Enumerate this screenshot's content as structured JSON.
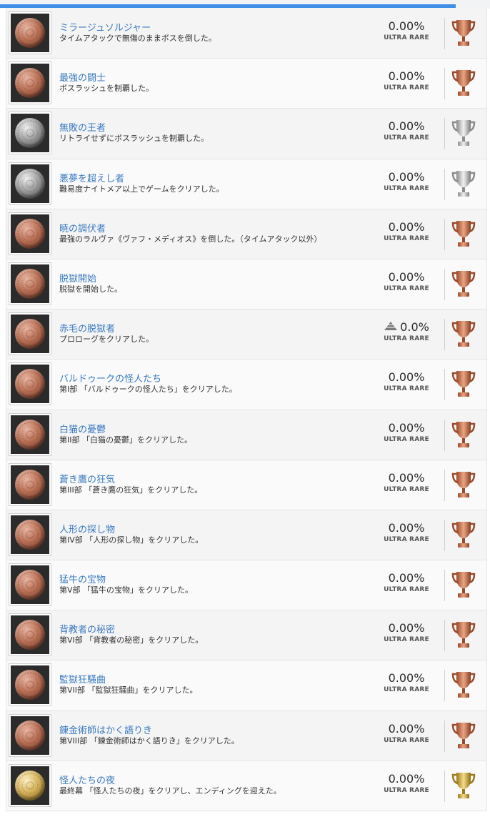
{
  "progress_percent": 93,
  "colors": {
    "title": "#3a79c1",
    "progress": "#3f8fe6",
    "bronze": "#c8714f",
    "silver": "#a8a8a8",
    "gold": "#c9a233"
  },
  "trophies": [
    {
      "title": "ミラージュソルジャー",
      "description": "タイムアタックで無傷のままボスを倒した。",
      "percent": "0.00%",
      "rarity": "ULTRA RARE",
      "grade": "bronze",
      "icon": "bronze-trophy-icon"
    },
    {
      "title": "最強の闘士",
      "description": "ボスラッシュを制覇した。",
      "percent": "0.00%",
      "rarity": "ULTRA RARE",
      "grade": "bronze",
      "icon": "bronze-trophy-icon"
    },
    {
      "title": "無敗の王者",
      "description": "リトライせずにボスラッシュを制覇した。",
      "percent": "0.00%",
      "rarity": "ULTRA RARE",
      "grade": "silver",
      "icon": "silver-trophy-icon"
    },
    {
      "title": "悪夢を超えし者",
      "description": "難易度ナイトメア以上でゲームをクリアした。",
      "percent": "0.00%",
      "rarity": "ULTRA RARE",
      "grade": "silver",
      "icon": "silver-trophy-icon"
    },
    {
      "title": "暁の調伏者",
      "description": "最強のラルヴァ《ヴァフ・メディオス》を倒した。（タイムアタック以外）",
      "percent": "0.00%",
      "rarity": "ULTRA RARE",
      "grade": "bronze",
      "icon": "bronze-trophy-icon"
    },
    {
      "title": "脱獄開始",
      "description": "脱獄を開始した。",
      "percent": "0.00%",
      "rarity": "ULTRA RARE",
      "grade": "bronze",
      "icon": "bronze-trophy-icon"
    },
    {
      "title": "赤毛の脱獄者",
      "description": "プロローグをクリアした。",
      "percent": "0.0%",
      "rarity": "ULTRA RARE",
      "grade": "bronze",
      "icon": "bronze-trophy-icon",
      "rarity_icon": "pyramid-icon"
    },
    {
      "title": "バルドゥークの怪人たち",
      "description": "第I部 「バルドゥークの怪人たち」をクリアした。",
      "percent": "0.00%",
      "rarity": "ULTRA RARE",
      "grade": "bronze",
      "icon": "bronze-trophy-icon"
    },
    {
      "title": "白猫の憂鬱",
      "description": "第II部 「白猫の憂鬱」をクリアした。",
      "percent": "0.00%",
      "rarity": "ULTRA RARE",
      "grade": "bronze",
      "icon": "bronze-trophy-icon"
    },
    {
      "title": "蒼き鷹の狂気",
      "description": "第III部 「蒼き鷹の狂気」をクリアした。",
      "percent": "0.00%",
      "rarity": "ULTRA RARE",
      "grade": "bronze",
      "icon": "bronze-trophy-icon"
    },
    {
      "title": "人形の探し物",
      "description": "第IV部 「人形の探し物」をクリアした。",
      "percent": "0.00%",
      "rarity": "ULTRA RARE",
      "grade": "bronze",
      "icon": "bronze-trophy-icon"
    },
    {
      "title": "猛牛の宝物",
      "description": "第V部 「猛牛の宝物」をクリアした。",
      "percent": "0.00%",
      "rarity": "ULTRA RARE",
      "grade": "bronze",
      "icon": "bronze-trophy-icon"
    },
    {
      "title": "背教者の秘密",
      "description": "第VI部 「背教者の秘密」をクリアした。",
      "percent": "0.00%",
      "rarity": "ULTRA RARE",
      "grade": "bronze",
      "icon": "bronze-trophy-icon"
    },
    {
      "title": "監獄狂騒曲",
      "description": "第VII部 「監獄狂騒曲」をクリアした。",
      "percent": "0.00%",
      "rarity": "ULTRA RARE",
      "grade": "bronze",
      "icon": "bronze-trophy-icon"
    },
    {
      "title": "錬金術師はかく語りき",
      "description": "第VIII部 「錬金術師はかく語りき」をクリアした。",
      "percent": "0.00%",
      "rarity": "ULTRA RARE",
      "grade": "bronze",
      "icon": "bronze-trophy-icon"
    },
    {
      "title": "怪人たちの夜",
      "description": "最終幕 「怪人たちの夜」をクリアし、エンディングを迎えた。",
      "percent": "0.00%",
      "rarity": "ULTRA RARE",
      "grade": "gold",
      "icon": "gold-trophy-icon"
    }
  ]
}
